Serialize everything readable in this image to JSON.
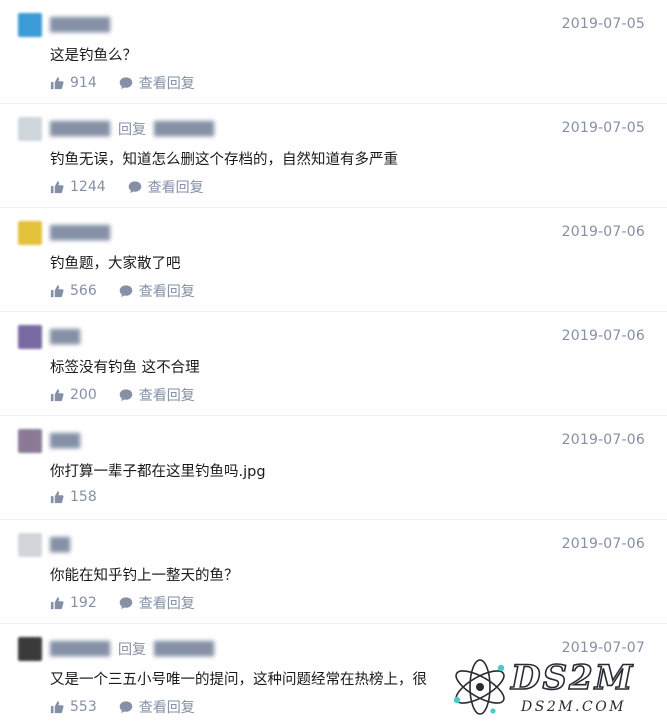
{
  "reply_word": "回复",
  "view_replies_label": "查看回复",
  "colors": {
    "meta": "#8590a6",
    "text": "#1a1a1a",
    "divider": "#f0f0f0"
  },
  "comments": [
    {
      "avatar_color": "#3a9bd6",
      "username": "",
      "reply_to": "",
      "date": "2019-07-05",
      "content": "这是钓鱼么？",
      "likes": "914",
      "has_view_replies": true
    },
    {
      "avatar_color": "#cfd6dc",
      "username": "",
      "reply_to": "",
      "date": "2019-07-05",
      "content": "钓鱼无误，知道怎么删这个存档的，自然知道有多严重",
      "likes": "1244",
      "has_view_replies": true
    },
    {
      "avatar_color": "#e3c13a",
      "username": "",
      "reply_to": "",
      "date": "2019-07-06",
      "content": "钓鱼题，大家散了吧",
      "likes": "566",
      "has_view_replies": true
    },
    {
      "avatar_color": "#7a6aa3",
      "username": "",
      "reply_to": "",
      "date": "2019-07-06",
      "content": "标签没有钓鱼 这不合理",
      "likes": "200",
      "has_view_replies": true
    },
    {
      "avatar_color": "#8a7a96",
      "username": "",
      "reply_to": "",
      "date": "2019-07-06",
      "content": "你打算一辈子都在这里钓鱼吗.jpg",
      "likes": "158",
      "has_view_replies": false
    },
    {
      "avatar_color": "#d2d6db",
      "username": "",
      "reply_to": "",
      "date": "2019-07-06",
      "content": "你能在知乎钓上一整天的鱼？",
      "likes": "192",
      "has_view_replies": true
    },
    {
      "avatar_color": "#3a3a3a",
      "username": "",
      "reply_to": "",
      "date": "2019-07-07",
      "content": "又是一个三五小号唯一的提问，这种问题经常在热榜上，很",
      "likes": "553",
      "has_view_replies": true
    }
  ],
  "watermark": {
    "title": "DS2M",
    "subtitle": "DS2M.COM"
  }
}
